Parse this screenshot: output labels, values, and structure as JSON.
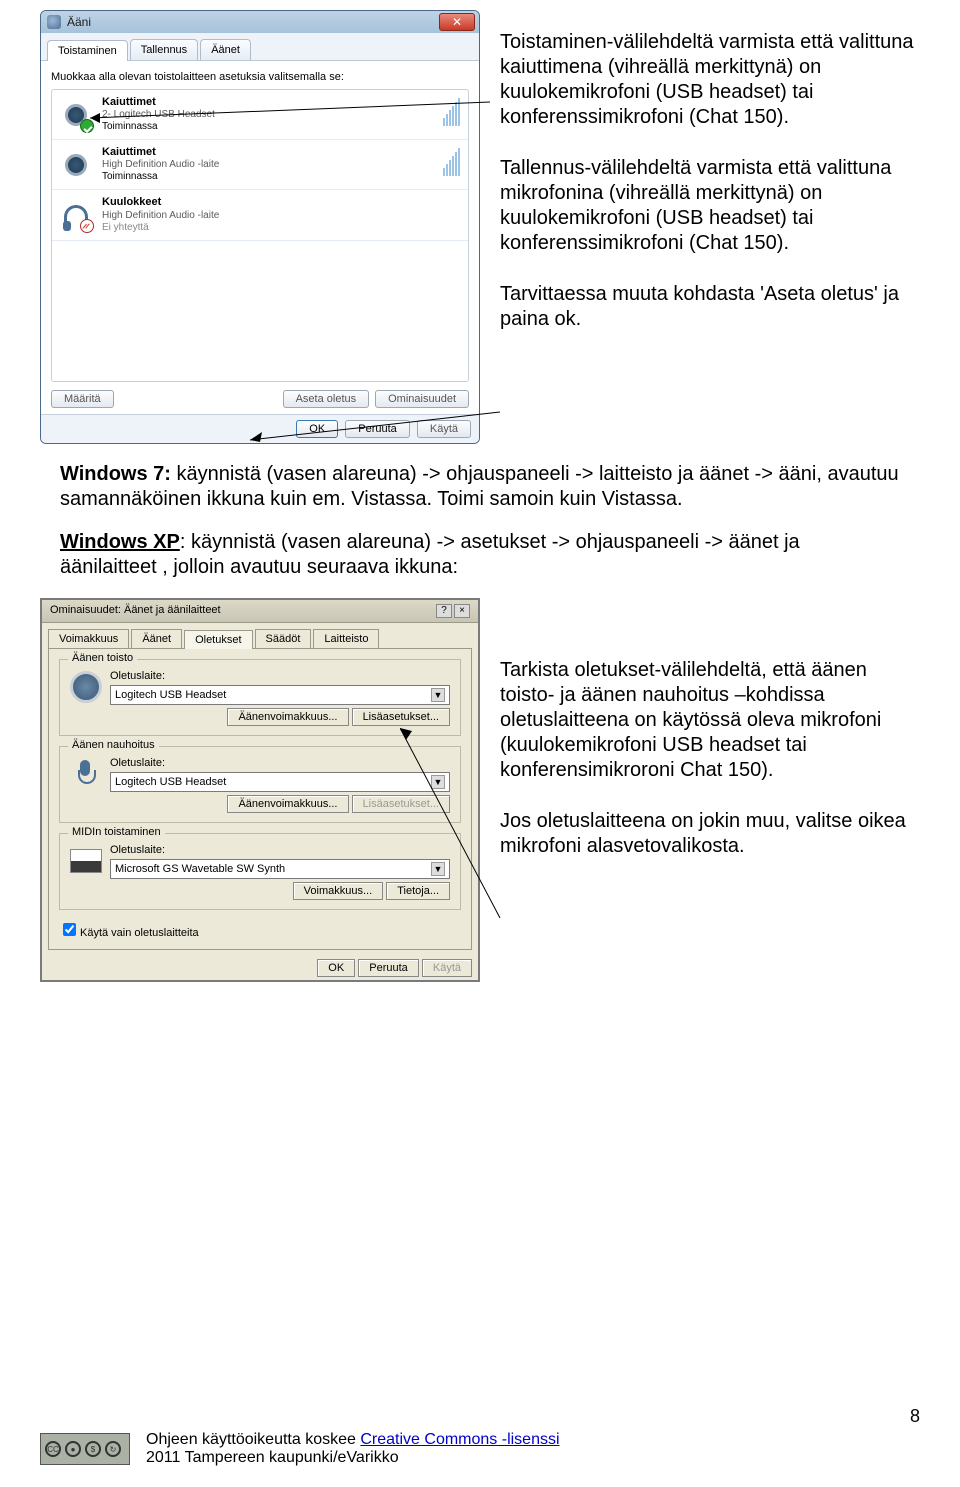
{
  "vista": {
    "title": "Ääni",
    "tabs": [
      "Toistaminen",
      "Tallennus",
      "Äänet"
    ],
    "bodyText": "Muokkaa alla olevan toistolaitteen asetuksia valitsemalla se:",
    "devices": [
      {
        "title": "Kaiuttimet",
        "line2": "2- Logitech USB Headset",
        "line3": "Toiminnassa",
        "icon": "speaker",
        "badge": "green"
      },
      {
        "title": "Kaiuttimet",
        "line2": "High Definition Audio -laite",
        "line3": "Toiminnassa",
        "icon": "speaker",
        "badge": ""
      },
      {
        "title": "Kuulokkeet",
        "line2": "High Definition Audio -laite",
        "line3": "Ei yhteyttä",
        "icon": "headphone",
        "badge": "red"
      }
    ],
    "buttons": {
      "set": "Määritä",
      "default": "Aseta oletus",
      "props": "Ominaisuudet"
    },
    "footer": {
      "ok": "OK",
      "cancel": "Peruuta",
      "apply": "Käytä"
    }
  },
  "callouts": {
    "c1": "Toistaminen-välilehdeltä varmista että valittuna kaiuttimena (vihreällä merkittynä) on kuulokemikrofoni (USB headset) tai konferenssimikrofoni (Chat 150).",
    "c2": "Tallennus-välilehdeltä varmista että valittuna mikrofonina (vihreällä merkittynä) on kuulokemikrofoni (USB headset) tai konferenssimikrofoni (Chat 150).",
    "c3": "Tarvittaessa muuta kohdasta 'Aseta oletus' ja paina ok."
  },
  "mid": {
    "win7_label": "Windows 7:",
    "win7_text": " käynnistä (vasen alareuna) -> ohjauspaneeli -> laitteisto ja äänet -> ääni, avautuu samannäköinen ikkuna kuin em. Vistassa. Toimi samoin kuin Vistassa.",
    "winxp_label": "Windows XP",
    "winxp_text": ": käynnistä (vasen alareuna) -> asetukset -> ohjauspaneeli -> äänet ja äänilaitteet , jolloin avautuu seuraava ikkuna:"
  },
  "xp": {
    "title": "Ominaisuudet: Äänet ja äänilaitteet",
    "help": "?",
    "close": "×",
    "tabs": [
      "Voimakkuus",
      "Äänet",
      "Oletukset",
      "Säädöt",
      "Laitteisto"
    ],
    "group_playback": "Äänen toisto",
    "group_record": "Äänen nauhoitus",
    "group_midi": "MIDIn toistaminen",
    "label_default": "Oletuslaite:",
    "select_playback": "Logitech USB Headset",
    "select_record": "Logitech USB Headset",
    "select_midi": "Microsoft GS Wavetable SW Synth",
    "btn_vol": "Äänenvoimakkuus...",
    "btn_adv": "Lisäasetukset...",
    "btn_vol2": "Voimakkuus...",
    "btn_info": "Tietoja...",
    "check": "Käytä vain oletuslaitteita",
    "footer": {
      "ok": "OK",
      "cancel": "Peruuta",
      "apply": "Käytä"
    }
  },
  "xp_callouts": {
    "c1": "Tarkista oletukset-välilehdeltä, että äänen toisto- ja äänen nauhoitus –kohdissa oletuslaitteena on käytössä oleva mikrofoni (kuulokemikrofoni USB headset tai konferensimikroroni Chat 150).",
    "c2": "Jos oletuslaitteena on jokin muu, valitse oikea mikrofoni alasvetovalikosta."
  },
  "footer": {
    "text1": "Ohjeen käyttöoikeutta koskee ",
    "link": "Creative Commons -lisenssi",
    "text2": "2011 Tampereen kaupunki/eVarikko",
    "cc_by": "BY",
    "cc_nc": "NC",
    "cc_sa": "SA",
    "pagenum": "8"
  }
}
